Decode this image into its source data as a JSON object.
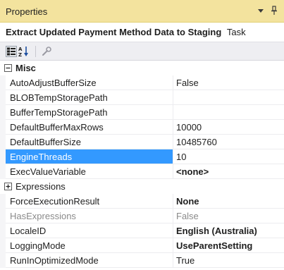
{
  "panel": {
    "title": "Properties",
    "object_name": "Extract Updated Payment Method Data to Staging",
    "object_type": "Task"
  },
  "toolbar": {
    "buttons": [
      "categorized-icon",
      "alphabetical-icon",
      "property-pages-icon"
    ]
  },
  "grid": {
    "categories": {
      "misc": "Misc",
      "expressions": "Expressions"
    },
    "rows": [
      {
        "name": "AutoAdjustBufferSize",
        "value": "False"
      },
      {
        "name": "BLOBTempStoragePath",
        "value": ""
      },
      {
        "name": "BufferTempStoragePath",
        "value": ""
      },
      {
        "name": "DefaultBufferMaxRows",
        "value": "10000"
      },
      {
        "name": "DefaultBufferSize",
        "value": "10485760"
      },
      {
        "name": "EngineThreads",
        "value": "10"
      },
      {
        "name": "ExecValueVariable",
        "value": "<none>"
      },
      {
        "name": "ForceExecutionResult",
        "value": "None"
      },
      {
        "name": "HasExpressions",
        "value": "False"
      },
      {
        "name": "LocaleID",
        "value": "English (Australia)"
      },
      {
        "name": "LoggingMode",
        "value": "UseParentSetting"
      },
      {
        "name": "RunInOptimizedMode",
        "value": "True"
      }
    ]
  },
  "colors": {
    "title_bar": "#f3e39e",
    "selection": "#3399ff"
  }
}
